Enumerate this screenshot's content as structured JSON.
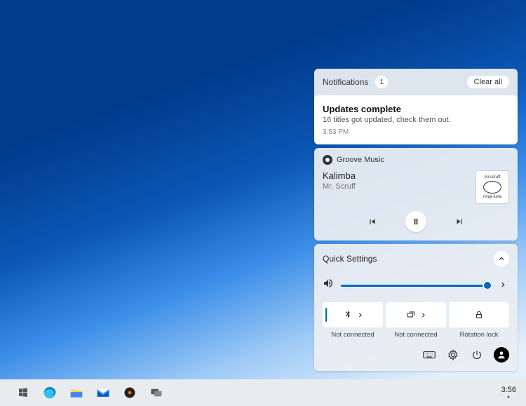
{
  "notifications": {
    "header_label": "Notifications",
    "count": "1",
    "clear_all_label": "Clear all",
    "items": [
      {
        "title": "Updates complete",
        "body": "16 titles got updated, check them out.",
        "timestamp": "3:53 PM"
      }
    ]
  },
  "media": {
    "app_name": "Groove Music",
    "track_title": "Kalimba",
    "artist": "Mr. Scruff",
    "album_art_top": "mr.scruff",
    "album_art_bottom": "ninja tuna"
  },
  "quick_settings": {
    "header_label": "Quick Settings",
    "tiles": [
      {
        "label": "Not connected"
      },
      {
        "label": "Not connected"
      },
      {
        "label": "Rotation lock"
      }
    ]
  },
  "taskbar": {
    "clock": "3:56"
  }
}
